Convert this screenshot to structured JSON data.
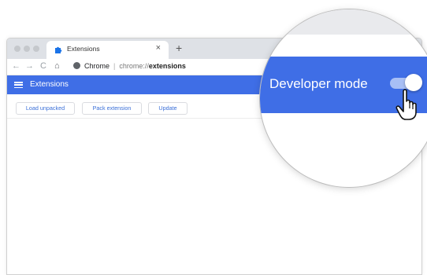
{
  "browser": {
    "tab": {
      "title": "Extensions",
      "close_glyph": "×",
      "icon": "puzzle-icon"
    },
    "new_tab_glyph": "+",
    "nav": {
      "back": "←",
      "forward": "→",
      "reload": "C",
      "home": "⌂"
    },
    "omnibox": {
      "site": "Chrome",
      "separator": "|",
      "url_prefix": "chrome://",
      "url_path": "extensions"
    }
  },
  "page": {
    "title": "Extensions",
    "menu_icon": "menu-icon",
    "actions": [
      "Load unpacked",
      "Pack extension",
      "Update"
    ]
  },
  "magnifier": {
    "label": "Developer mode",
    "toggle_on": true,
    "cursor": "hand-pointer-icon"
  },
  "colors": {
    "accent": "#3f6ee6",
    "button_text": "#3a6fd8",
    "tabstrip": "#dee1e6",
    "toggle_track_on": "#a8bff5"
  }
}
